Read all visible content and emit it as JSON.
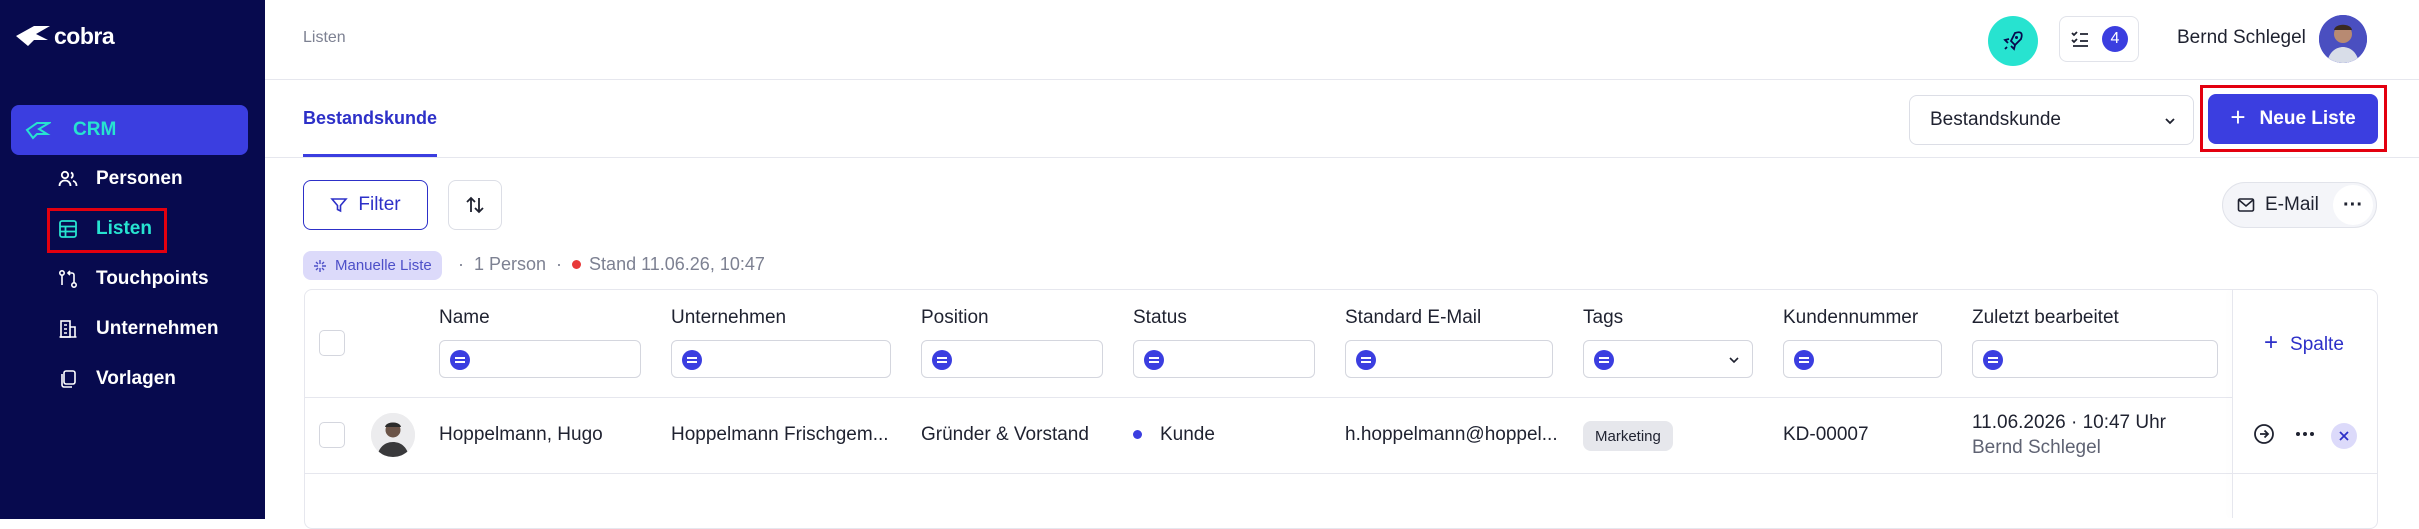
{
  "app": {
    "logo_text": "cobra"
  },
  "sidebar": {
    "crm_label": "CRM",
    "items": [
      {
        "label": "Personen"
      },
      {
        "label": "Listen"
      },
      {
        "label": "Touchpoints"
      },
      {
        "label": "Unternehmen"
      },
      {
        "label": "Vorlagen"
      }
    ]
  },
  "header": {
    "breadcrumb": "Listen",
    "tasks_count": "4",
    "user_name": "Bernd Schlegel"
  },
  "tabs": [
    {
      "label": "Bestandskunde"
    }
  ],
  "toolbar": {
    "list_select_value": "Bestandskunde",
    "new_list_label": "Neue Liste",
    "filter_label": "Filter",
    "email_label": "E-Mail",
    "more_label": "···"
  },
  "list_info": {
    "chip_label": "Manuelle Liste",
    "count": "1 Person",
    "stand": "Stand 11.06.26, 10:47"
  },
  "table": {
    "columns": [
      "Name",
      "Unternehmen",
      "Position",
      "Status",
      "Standard E-Mail",
      "Tags",
      "Kundennummer",
      "Zuletzt bearbeitet"
    ],
    "add_column_label": "Spalte",
    "rows": [
      {
        "name": "Hoppelmann, Hugo",
        "company": "Hoppelmann Frischgem...",
        "position": "Gründer & Vorstand",
        "status": "Kunde",
        "email": "h.hoppelmann@hoppel...",
        "tag": "Marketing",
        "customer_no": "KD-00007",
        "edited_date": "11.06.2026 · 10:47 Uhr",
        "edited_by": "Bernd Schlegel"
      }
    ]
  },
  "colors": {
    "sidebar_bg": "#070a4e",
    "accent": "#3b3ee0",
    "teal": "#27e3d0",
    "highlight_box": "#e3000f"
  }
}
